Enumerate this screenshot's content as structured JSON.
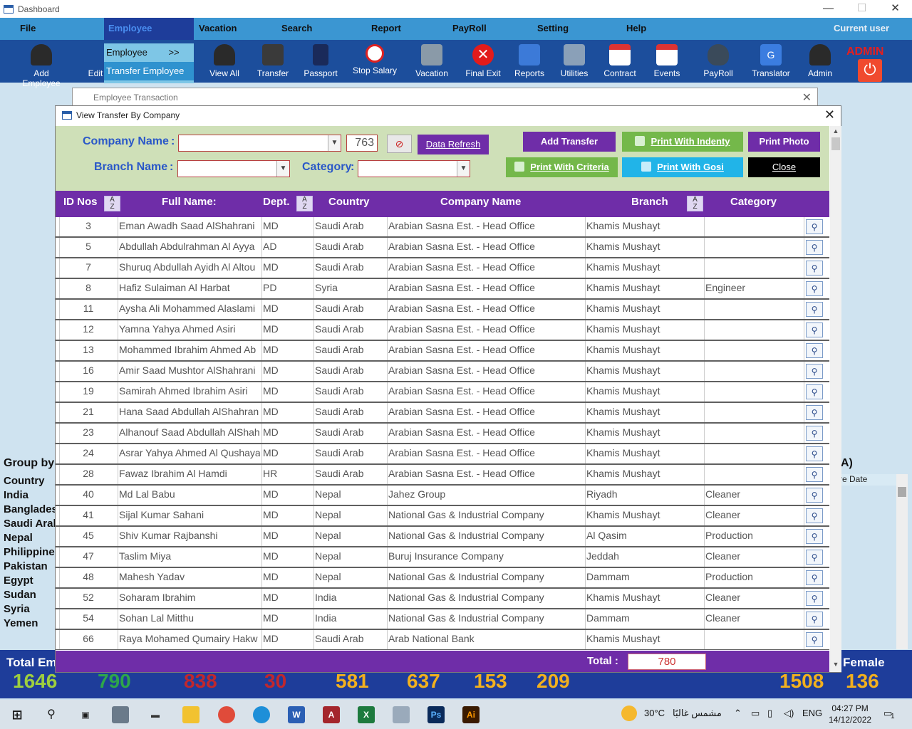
{
  "app": {
    "title": "Dashboard"
  },
  "menu": {
    "items": [
      "File",
      "Employee",
      "Vacation",
      "Search",
      "Report",
      "PayRoll",
      "Setting",
      "Help"
    ],
    "current_user": "Current user"
  },
  "employee_menu": {
    "item1": "Employee",
    "item1_arrow": ">>",
    "item2": "Transfer Employee"
  },
  "toolbar": {
    "items": [
      "Add Employee",
      "Edit",
      "View All",
      "Transfer",
      "Passport",
      "Stop Salary",
      "Vacation",
      "Final Exit",
      "Reports",
      "Utilities",
      "Contract",
      "Events",
      "PayRoll",
      "Translator",
      "Admin"
    ],
    "admin_label": "ADMIN"
  },
  "background_window": {
    "title": "Employee Transaction"
  },
  "dialog": {
    "title": "View Transfer By Company",
    "company_label": "Company Name",
    "branch_label": "Branch Name",
    "category_label": "Category",
    "colon": ":",
    "company_value": "",
    "branch_value": "",
    "category_value": "",
    "count": "763",
    "buttons": {
      "data_refresh": "Data Refresh",
      "add_transfer": "Add Transfer",
      "print_with_indenty": "Print With Indenty",
      "print_photo": "Print Photo",
      "print_with_criteria": "Print With Criteria",
      "print_with_gosi": "Print With Gosi",
      "close": "Close"
    },
    "columns": [
      "ID Nos",
      "Full Name:",
      "Dept.",
      "Country",
      "Company Name",
      "Branch",
      "Category"
    ],
    "rows": [
      {
        "id": "3",
        "name": "Eman Awadh Saad AlShahrani",
        "dept": "MD",
        "country": "Saudi Arab",
        "company": "Arabian Sasna Est. - Head Office",
        "branch": "Khamis Mushayt",
        "category": ""
      },
      {
        "id": "5",
        "name": "Abdullah Abdulrahman Al Ayya",
        "dept": "AD",
        "country": "Saudi Arab",
        "company": "Arabian Sasna Est. - Head Office",
        "branch": "Khamis Mushayt",
        "category": ""
      },
      {
        "id": "7",
        "name": "Shuruq Abdullah Ayidh Al  Altou",
        "dept": "MD",
        "country": "Saudi Arab",
        "company": "Arabian Sasna Est. - Head Office",
        "branch": "Khamis Mushayt",
        "category": ""
      },
      {
        "id": "8",
        "name": "Hafiz Sulaiman Al Harbat",
        "dept": "PD",
        "country": "Syria",
        "company": "Arabian Sasna Est. - Head Office",
        "branch": "Khamis Mushayt",
        "category": "Engineer"
      },
      {
        "id": "11",
        "name": "Aysha Ali Mohammed Alaslami",
        "dept": "MD",
        "country": "Saudi Arab",
        "company": "Arabian Sasna Est. - Head Office",
        "branch": "Khamis Mushayt",
        "category": ""
      },
      {
        "id": "12",
        "name": "Yamna Yahya Ahmed Asiri",
        "dept": "MD",
        "country": "Saudi Arab",
        "company": "Arabian Sasna Est. - Head Office",
        "branch": "Khamis Mushayt",
        "category": ""
      },
      {
        "id": "13",
        "name": "Mohammed Ibrahim Ahmed Ab",
        "dept": "MD",
        "country": "Saudi Arab",
        "company": "Arabian Sasna Est. - Head Office",
        "branch": "Khamis Mushayt",
        "category": ""
      },
      {
        "id": "16",
        "name": "Amir Saad Mushtor AlShahrani",
        "dept": "MD",
        "country": "Saudi Arab",
        "company": "Arabian Sasna Est. - Head Office",
        "branch": "Khamis Mushayt",
        "category": ""
      },
      {
        "id": "19",
        "name": "Samirah Ahmed Ibrahim Asiri",
        "dept": "MD",
        "country": "Saudi Arab",
        "company": "Arabian Sasna Est. - Head Office",
        "branch": "Khamis Mushayt",
        "category": ""
      },
      {
        "id": "21",
        "name": "Hana Saad Abdullah AlShahran",
        "dept": "MD",
        "country": "Saudi Arab",
        "company": "Arabian Sasna Est. - Head Office",
        "branch": "Khamis Mushayt",
        "category": ""
      },
      {
        "id": "23",
        "name": "Alhanouf Saad Abdullah AlShah",
        "dept": "MD",
        "country": "Saudi Arab",
        "company": "Arabian Sasna Est. - Head Office",
        "branch": "Khamis Mushayt",
        "category": ""
      },
      {
        "id": "24",
        "name": "Asrar Yahya Ahmed Al Qushaya",
        "dept": "MD",
        "country": "Saudi Arab",
        "company": "Arabian Sasna Est. - Head Office",
        "branch": "Khamis Mushayt",
        "category": ""
      },
      {
        "id": "28",
        "name": "Fawaz Ibrahim Al Hamdi",
        "dept": "HR",
        "country": "Saudi Arab",
        "company": "Arabian Sasna Est. - Head Office",
        "branch": "Khamis Mushayt",
        "category": ""
      },
      {
        "id": "40",
        "name": "Md Lal Babu",
        "dept": "MD",
        "country": "Nepal",
        "company": "Jahez Group",
        "branch": "Riyadh",
        "category": "Cleaner"
      },
      {
        "id": "41",
        "name": "Sijal Kumar Sahani",
        "dept": "MD",
        "country": "Nepal",
        "company": "National Gas & Industrial Company",
        "branch": "Khamis Mushayt",
        "category": "Cleaner"
      },
      {
        "id": "45",
        "name": "Shiv Kumar Rajbanshi",
        "dept": "MD",
        "country": "Nepal",
        "company": "National Gas & Industrial Company",
        "branch": "Al Qasim",
        "category": "Production"
      },
      {
        "id": "47",
        "name": "Taslim Miya",
        "dept": "MD",
        "country": "Nepal",
        "company": "Buruj Insurance Company",
        "branch": "Jeddah",
        "category": "Cleaner"
      },
      {
        "id": "48",
        "name": "Mahesh Yadav",
        "dept": "MD",
        "country": "Nepal",
        "company": "National Gas & Industrial Company",
        "branch": "Dammam",
        "category": "Production"
      },
      {
        "id": "52",
        "name": "Soharam Ibrahim",
        "dept": "MD",
        "country": "India",
        "company": "National Gas & Industrial Company",
        "branch": "Khamis Mushayt",
        "category": "Cleaner"
      },
      {
        "id": "54",
        "name": "Sohan Lal Mitthu",
        "dept": "MD",
        "country": "India",
        "company": "National Gas & Industrial Company",
        "branch": "Dammam",
        "category": "Cleaner"
      },
      {
        "id": "66",
        "name": "Raya Mohamed Qumairy Hakw",
        "dept": "MD",
        "country": "Saudi Arab",
        "company": "Arab National Bank",
        "branch": "Khamis Mushayt",
        "category": ""
      }
    ],
    "total_label": "Total :",
    "total_value": "780"
  },
  "dashboard": {
    "group_by": "Group by",
    "countries": [
      "Country",
      "India",
      "Bangladesh",
      "Saudi Arab",
      "Nepal",
      "Philippine",
      "Pakistan",
      "Egypt",
      "Sudan",
      "Syria",
      "Yemen"
    ],
    "right_header": "re Date",
    "right_paren": "A)",
    "total_title": "Total Em",
    "female_title": "Female",
    "totals": [
      {
        "value": "1646",
        "color": "#9ecf3e"
      },
      {
        "value": "790",
        "color": "#2ea64a"
      },
      {
        "value": "838",
        "color": "#c0272d"
      },
      {
        "value": "30",
        "color": "#c0272d"
      },
      {
        "value": "581",
        "color": "#f2b01e"
      },
      {
        "value": "637",
        "color": "#f2b01e"
      },
      {
        "value": "153",
        "color": "#f2b01e"
      },
      {
        "value": "209",
        "color": "#f2b01e"
      },
      {
        "value": "1508",
        "color": "#f2b01e"
      },
      {
        "value": "136",
        "color": "#f2b01e"
      }
    ]
  },
  "taskbar": {
    "weather": "30°C",
    "weather_text": "مشمس غالبًا",
    "lang": "ENG",
    "time": "04:27 PM",
    "date": "14/12/2022",
    "notif": "1"
  }
}
